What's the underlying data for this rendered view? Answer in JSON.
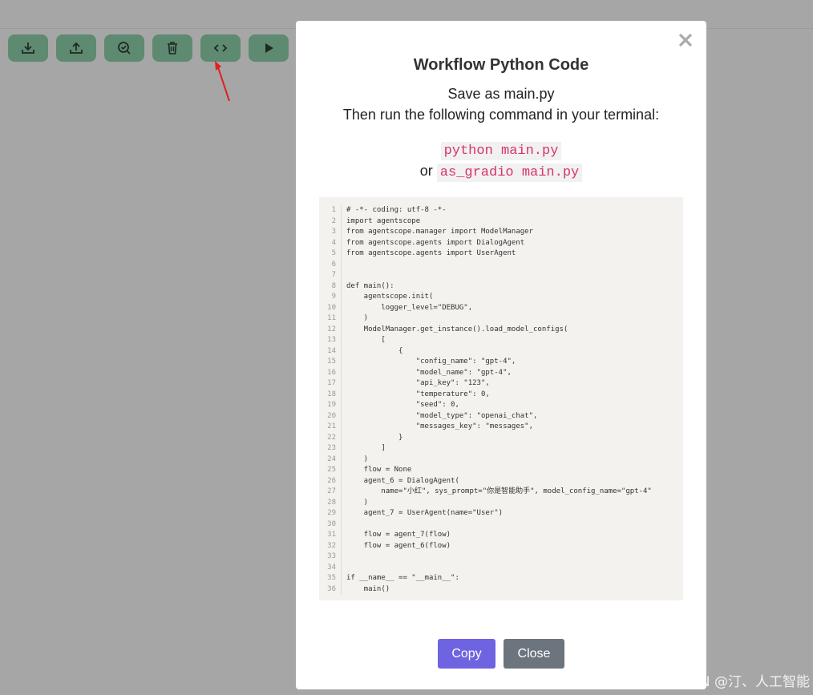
{
  "toolbar": {
    "buttons": [
      {
        "name": "download",
        "icon": "download-icon"
      },
      {
        "name": "upload",
        "icon": "upload-icon"
      },
      {
        "name": "check",
        "icon": "search-check-icon"
      },
      {
        "name": "delete",
        "icon": "trash-icon"
      },
      {
        "name": "code",
        "icon": "code-icon"
      },
      {
        "name": "run",
        "icon": "play-icon"
      }
    ]
  },
  "colors": {
    "toolbar_button": "#5e8a72",
    "copy_button": "#6e63e0",
    "close_button": "#6c757d",
    "command_text": "#d6336c",
    "annotation_arrow": "#e02020"
  },
  "modal": {
    "title": "Workflow Python Code",
    "instruction_line1": "Save as main.py",
    "instruction_line2": "Then run the following command in your terminal:",
    "command1": "python main.py",
    "or_text": "or",
    "command2": "as_gradio main.py",
    "copy_label": "Copy",
    "close_label": "Close",
    "code_lines": [
      "# -*- coding: utf-8 -*-",
      "import agentscope",
      "from agentscope.manager import ModelManager",
      "from agentscope.agents import DialogAgent",
      "from agentscope.agents import UserAgent",
      "",
      "",
      "def main():",
      "    agentscope.init(",
      "        logger_level=\"DEBUG\",",
      "    )",
      "    ModelManager.get_instance().load_model_configs(",
      "        [",
      "            {",
      "                \"config_name\": \"gpt-4\",",
      "                \"model_name\": \"gpt-4\",",
      "                \"api_key\": \"123\",",
      "                \"temperature\": 0,",
      "                \"seed\": 0,",
      "                \"model_type\": \"openai_chat\",",
      "                \"messages_key\": \"messages\",",
      "            }",
      "        ]",
      "    )",
      "    flow = None",
      "    agent_6 = DialogAgent(",
      "        name=\"小红\", sys_prompt=\"你是智能助手\", model_config_name=\"gpt-4\"",
      "    )",
      "    agent_7 = UserAgent(name=\"User\")",
      "",
      "    flow = agent_7(flow)",
      "    flow = agent_6(flow)",
      "",
      "",
      "if __name__ == \"__main__\":",
      "    main()"
    ]
  },
  "watermark": "CSDN @汀、人工智能"
}
